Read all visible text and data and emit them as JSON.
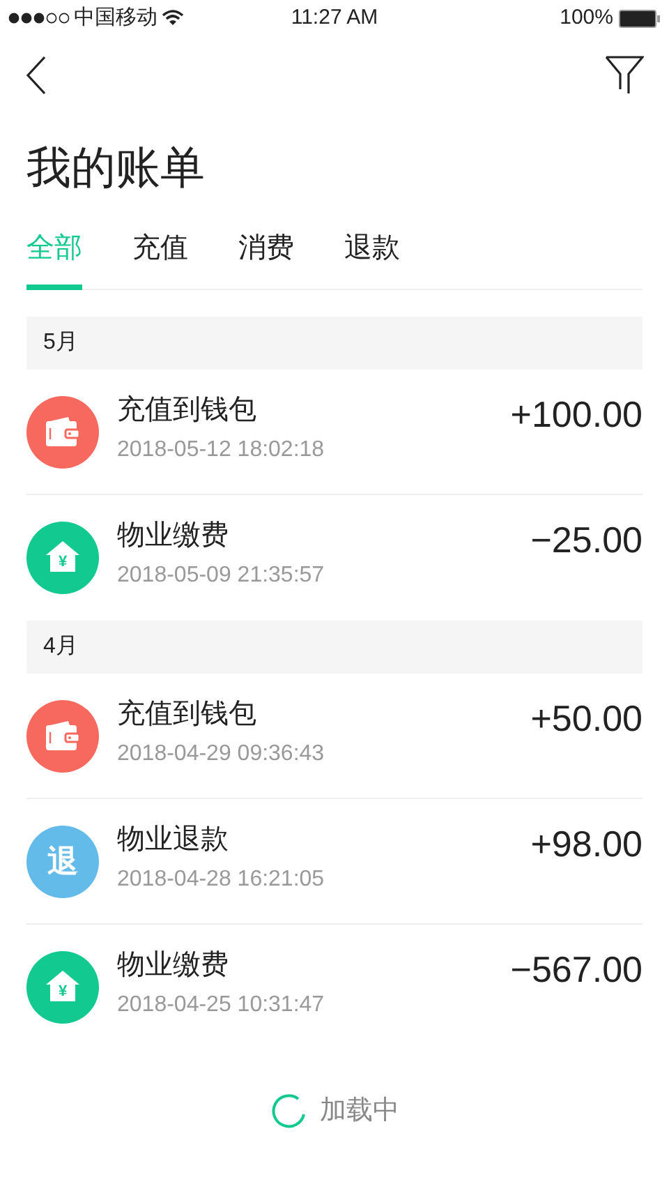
{
  "status_bar": {
    "carrier": "中国移动",
    "time": "11:27 AM",
    "battery": "100%"
  },
  "title": "我的账单",
  "tabs": [
    {
      "label": "全部",
      "selected": true
    },
    {
      "label": "充值",
      "selected": false
    },
    {
      "label": "消费",
      "selected": false
    },
    {
      "label": "退款",
      "selected": false
    }
  ],
  "sections": [
    {
      "header": "5月",
      "items": [
        {
          "kind": "wallet",
          "title": "充值到钱包",
          "time": "2018-05-12 18:02:18",
          "amount": "+100.00"
        },
        {
          "kind": "house",
          "icon_text": "¥",
          "title": "物业缴费",
          "time": "2018-05-09 21:35:57",
          "amount": "−25.00"
        }
      ]
    },
    {
      "header": "4月",
      "items": [
        {
          "kind": "wallet",
          "title": "充值到钱包",
          "time": "2018-04-29 09:36:43",
          "amount": "+50.00"
        },
        {
          "kind": "refund",
          "icon_text": "退",
          "title": "物业退款",
          "time": "2018-04-28 16:21:05",
          "amount": "+98.00"
        },
        {
          "kind": "house",
          "icon_text": "¥",
          "title": "物业缴费",
          "time": "2018-04-25 10:31:47",
          "amount": "−567.00"
        }
      ]
    }
  ],
  "loading": "加载中"
}
